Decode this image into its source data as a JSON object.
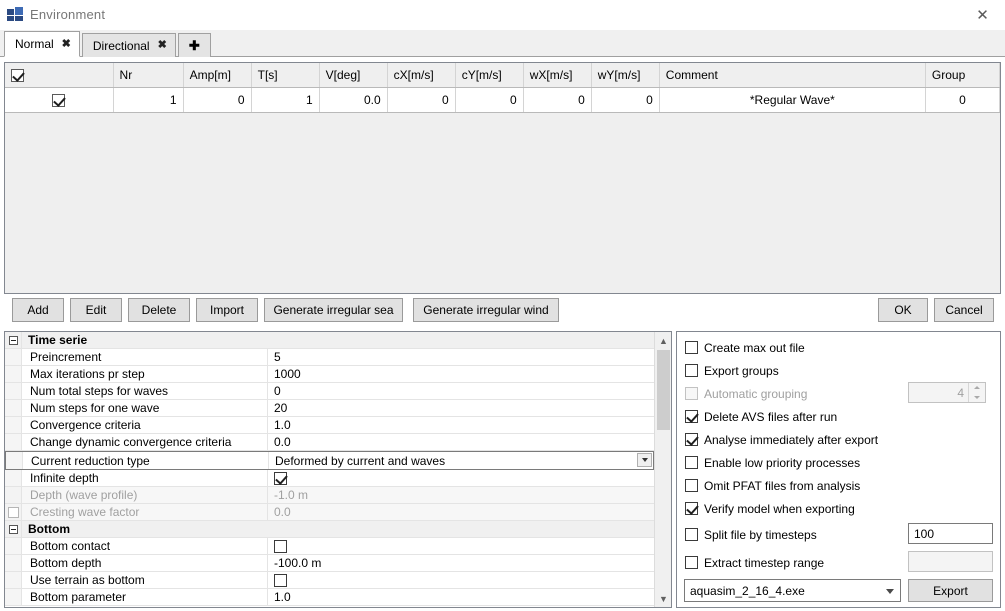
{
  "window": {
    "title": "Environment",
    "icon": "app-icon",
    "close_label": "✕"
  },
  "tabs": {
    "items": [
      {
        "label": "Normal",
        "close": "✖",
        "active": true
      },
      {
        "label": "Directional",
        "close": "✖",
        "active": false
      }
    ],
    "add_label": "✚"
  },
  "table": {
    "headers": [
      "",
      "Nr",
      "Amp[m]",
      "T[s]",
      "V[deg]",
      "cX[m/s]",
      "cY[m/s]",
      "wX[m/s]",
      "wY[m/s]",
      "Comment",
      "Group"
    ],
    "header_checked": true,
    "rows": [
      {
        "checked": true,
        "nr": "1",
        "amp": "0",
        "t": "1",
        "v": "0.0",
        "cx": "0",
        "cy": "0",
        "wx": "0",
        "wy": "0",
        "comment": "*Regular Wave*",
        "group": "0"
      }
    ]
  },
  "toolbar": {
    "add": "Add",
    "edit": "Edit",
    "delete": "Delete",
    "import": "Import",
    "generate_sea": "Generate irregular sea",
    "generate_wind": "Generate irregular wind",
    "ok": "OK",
    "cancel": "Cancel"
  },
  "properties": {
    "sections": [
      {
        "title": "Time serie",
        "rows": [
          {
            "name": "Preincrement",
            "value": "5",
            "type": "text",
            "disabled": false
          },
          {
            "name": "Max iterations pr step",
            "value": "1000",
            "type": "text",
            "disabled": false
          },
          {
            "name": "Num total steps for waves",
            "value": "0",
            "type": "text",
            "disabled": false
          },
          {
            "name": "Num steps for one wave",
            "value": "20",
            "type": "text",
            "disabled": false
          },
          {
            "name": "Convergence criteria",
            "value": "1.0",
            "type": "text",
            "disabled": false
          },
          {
            "name": "Change dynamic convergence criteria",
            "value": "0.0",
            "type": "text",
            "disabled": false
          },
          {
            "name": "Current reduction type",
            "value": "Deformed by current and waves",
            "type": "combo",
            "disabled": false
          },
          {
            "name": "Infinite depth",
            "value": "",
            "type": "checkbox",
            "checked": true,
            "disabled": false
          },
          {
            "name": "Depth (wave profile)",
            "value": "-1.0 m",
            "type": "text",
            "disabled": true
          },
          {
            "name": "Cresting wave factor",
            "value": "0.0",
            "type": "text",
            "disabled": true,
            "row_checkbox": true,
            "row_checked": false
          }
        ]
      },
      {
        "title": "Bottom",
        "rows": [
          {
            "name": "Bottom contact",
            "value": "",
            "type": "checkbox",
            "checked": false,
            "disabled": false
          },
          {
            "name": "Bottom depth",
            "value": "-100.0 m",
            "type": "text",
            "disabled": false
          },
          {
            "name": "Use terrain as bottom",
            "value": "",
            "type": "checkbox",
            "checked": false,
            "disabled": false
          },
          {
            "name": "Bottom parameter",
            "value": "1.0",
            "type": "text",
            "disabled": false
          }
        ]
      }
    ]
  },
  "options": {
    "checkboxes": [
      {
        "label": "Create max out file",
        "checked": false,
        "disabled": false
      },
      {
        "label": "Export groups",
        "checked": false,
        "disabled": false
      },
      {
        "label": "Automatic grouping",
        "checked": false,
        "disabled": true
      },
      {
        "label": "Delete AVS files after run",
        "checked": true,
        "disabled": false
      },
      {
        "label": "Analyse immediately after export",
        "checked": true,
        "disabled": false
      },
      {
        "label": "Enable low priority processes",
        "checked": false,
        "disabled": false
      },
      {
        "label": "Omit PFAT files from analysis",
        "checked": false,
        "disabled": false
      },
      {
        "label": "Verify model when exporting",
        "checked": true,
        "disabled": false
      },
      {
        "label": "Split file by timesteps",
        "checked": false,
        "disabled": false
      },
      {
        "label": "Extract timestep range",
        "checked": false,
        "disabled": false
      }
    ],
    "grouping_count": "4",
    "split_value": "100",
    "extract_value": "",
    "executable": "aquasim_2_16_4.exe",
    "export_label": "Export"
  }
}
